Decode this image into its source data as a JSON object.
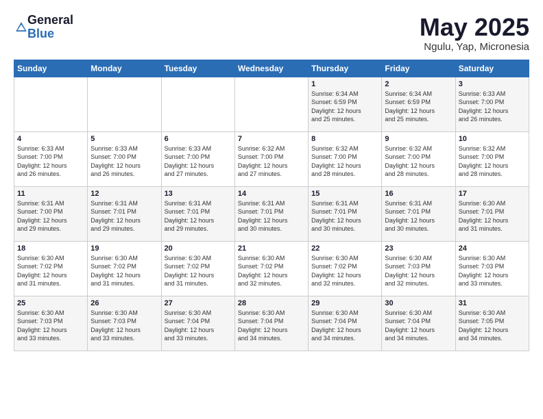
{
  "header": {
    "logo_general": "General",
    "logo_blue": "Blue",
    "month_title": "May 2025",
    "location": "Ngulu, Yap, Micronesia"
  },
  "days_of_week": [
    "Sunday",
    "Monday",
    "Tuesday",
    "Wednesday",
    "Thursday",
    "Friday",
    "Saturday"
  ],
  "weeks": [
    [
      {
        "day": "",
        "info": ""
      },
      {
        "day": "",
        "info": ""
      },
      {
        "day": "",
        "info": ""
      },
      {
        "day": "",
        "info": ""
      },
      {
        "day": "1",
        "info": "Sunrise: 6:34 AM\nSunset: 6:59 PM\nDaylight: 12 hours\nand 25 minutes."
      },
      {
        "day": "2",
        "info": "Sunrise: 6:34 AM\nSunset: 6:59 PM\nDaylight: 12 hours\nand 25 minutes."
      },
      {
        "day": "3",
        "info": "Sunrise: 6:33 AM\nSunset: 7:00 PM\nDaylight: 12 hours\nand 26 minutes."
      }
    ],
    [
      {
        "day": "4",
        "info": "Sunrise: 6:33 AM\nSunset: 7:00 PM\nDaylight: 12 hours\nand 26 minutes."
      },
      {
        "day": "5",
        "info": "Sunrise: 6:33 AM\nSunset: 7:00 PM\nDaylight: 12 hours\nand 26 minutes."
      },
      {
        "day": "6",
        "info": "Sunrise: 6:33 AM\nSunset: 7:00 PM\nDaylight: 12 hours\nand 27 minutes."
      },
      {
        "day": "7",
        "info": "Sunrise: 6:32 AM\nSunset: 7:00 PM\nDaylight: 12 hours\nand 27 minutes."
      },
      {
        "day": "8",
        "info": "Sunrise: 6:32 AM\nSunset: 7:00 PM\nDaylight: 12 hours\nand 28 minutes."
      },
      {
        "day": "9",
        "info": "Sunrise: 6:32 AM\nSunset: 7:00 PM\nDaylight: 12 hours\nand 28 minutes."
      },
      {
        "day": "10",
        "info": "Sunrise: 6:32 AM\nSunset: 7:00 PM\nDaylight: 12 hours\nand 28 minutes."
      }
    ],
    [
      {
        "day": "11",
        "info": "Sunrise: 6:31 AM\nSunset: 7:00 PM\nDaylight: 12 hours\nand 29 minutes."
      },
      {
        "day": "12",
        "info": "Sunrise: 6:31 AM\nSunset: 7:01 PM\nDaylight: 12 hours\nand 29 minutes."
      },
      {
        "day": "13",
        "info": "Sunrise: 6:31 AM\nSunset: 7:01 PM\nDaylight: 12 hours\nand 29 minutes."
      },
      {
        "day": "14",
        "info": "Sunrise: 6:31 AM\nSunset: 7:01 PM\nDaylight: 12 hours\nand 30 minutes."
      },
      {
        "day": "15",
        "info": "Sunrise: 6:31 AM\nSunset: 7:01 PM\nDaylight: 12 hours\nand 30 minutes."
      },
      {
        "day": "16",
        "info": "Sunrise: 6:31 AM\nSunset: 7:01 PM\nDaylight: 12 hours\nand 30 minutes."
      },
      {
        "day": "17",
        "info": "Sunrise: 6:30 AM\nSunset: 7:01 PM\nDaylight: 12 hours\nand 31 minutes."
      }
    ],
    [
      {
        "day": "18",
        "info": "Sunrise: 6:30 AM\nSunset: 7:02 PM\nDaylight: 12 hours\nand 31 minutes."
      },
      {
        "day": "19",
        "info": "Sunrise: 6:30 AM\nSunset: 7:02 PM\nDaylight: 12 hours\nand 31 minutes."
      },
      {
        "day": "20",
        "info": "Sunrise: 6:30 AM\nSunset: 7:02 PM\nDaylight: 12 hours\nand 31 minutes."
      },
      {
        "day": "21",
        "info": "Sunrise: 6:30 AM\nSunset: 7:02 PM\nDaylight: 12 hours\nand 32 minutes."
      },
      {
        "day": "22",
        "info": "Sunrise: 6:30 AM\nSunset: 7:02 PM\nDaylight: 12 hours\nand 32 minutes."
      },
      {
        "day": "23",
        "info": "Sunrise: 6:30 AM\nSunset: 7:03 PM\nDaylight: 12 hours\nand 32 minutes."
      },
      {
        "day": "24",
        "info": "Sunrise: 6:30 AM\nSunset: 7:03 PM\nDaylight: 12 hours\nand 33 minutes."
      }
    ],
    [
      {
        "day": "25",
        "info": "Sunrise: 6:30 AM\nSunset: 7:03 PM\nDaylight: 12 hours\nand 33 minutes."
      },
      {
        "day": "26",
        "info": "Sunrise: 6:30 AM\nSunset: 7:03 PM\nDaylight: 12 hours\nand 33 minutes."
      },
      {
        "day": "27",
        "info": "Sunrise: 6:30 AM\nSunset: 7:04 PM\nDaylight: 12 hours\nand 33 minutes."
      },
      {
        "day": "28",
        "info": "Sunrise: 6:30 AM\nSunset: 7:04 PM\nDaylight: 12 hours\nand 34 minutes."
      },
      {
        "day": "29",
        "info": "Sunrise: 6:30 AM\nSunset: 7:04 PM\nDaylight: 12 hours\nand 34 minutes."
      },
      {
        "day": "30",
        "info": "Sunrise: 6:30 AM\nSunset: 7:04 PM\nDaylight: 12 hours\nand 34 minutes."
      },
      {
        "day": "31",
        "info": "Sunrise: 6:30 AM\nSunset: 7:05 PM\nDaylight: 12 hours\nand 34 minutes."
      }
    ]
  ]
}
